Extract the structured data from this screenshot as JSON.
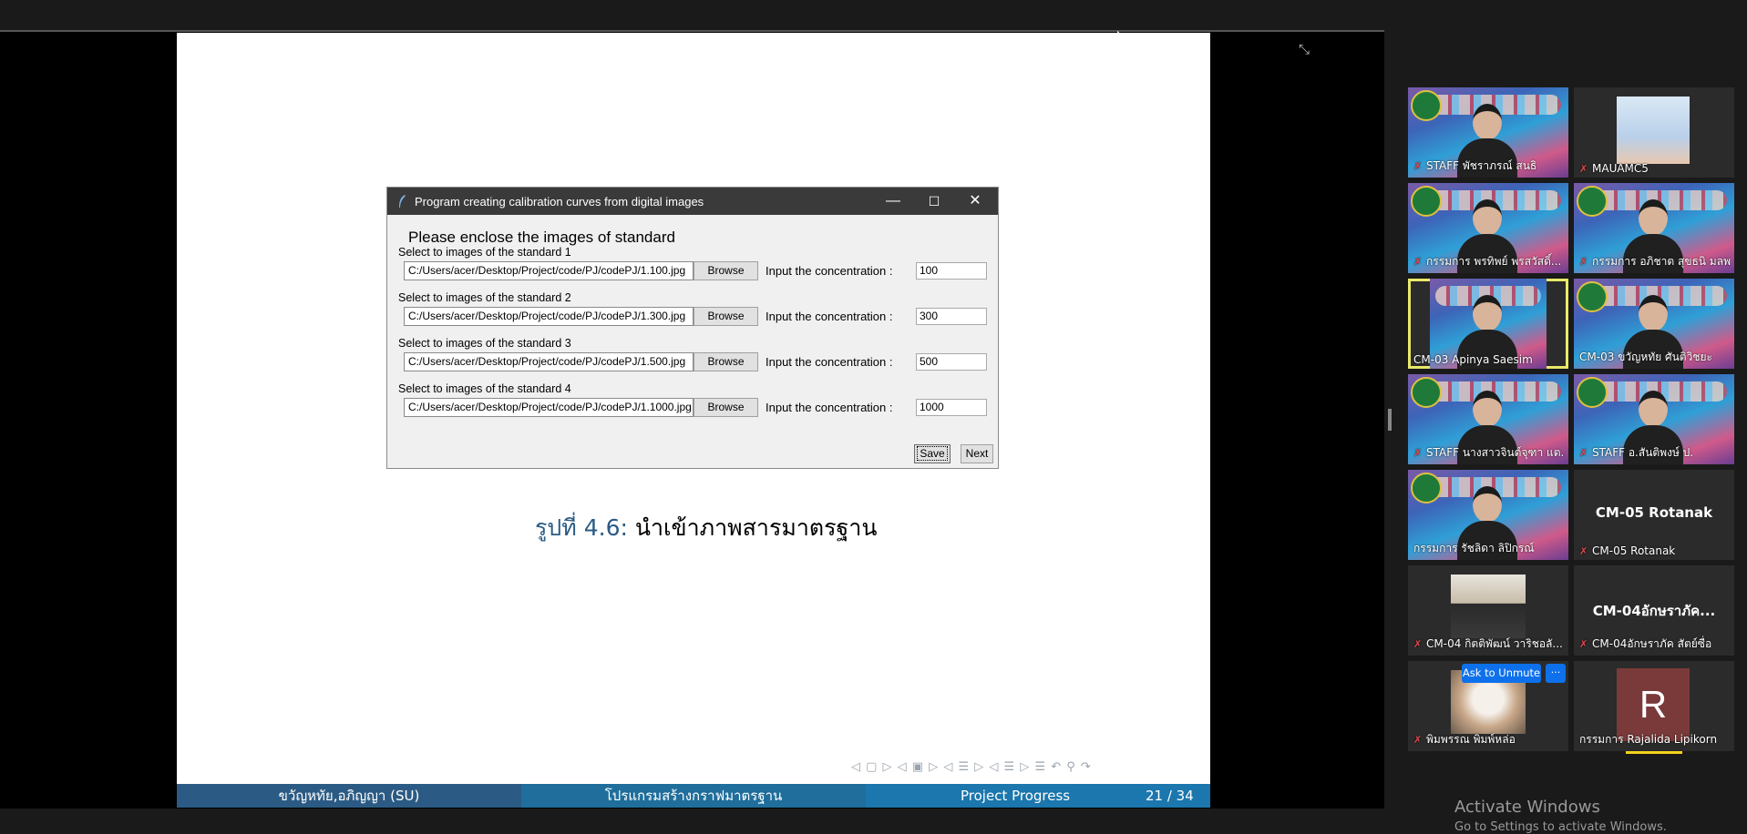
{
  "dialog": {
    "title": "Program creating calibration curves from digital images",
    "minimize_glyph": "—",
    "maximize_glyph": "☐",
    "close_glyph": "✕",
    "heading": "Please enclose the images of standard",
    "rows": [
      {
        "label": "Select to images of the standard 1",
        "path": "C:/Users/acer/Desktop/Project/code/PJ/codePJ/1.100.jpg",
        "browse": "Browse",
        "conc_label": "Input the concentration :",
        "conc": "100"
      },
      {
        "label": "Select to images of the standard 2",
        "path": "C:/Users/acer/Desktop/Project/code/PJ/codePJ/1.300.jpg",
        "browse": "Browse",
        "conc_label": "Input the concentration :",
        "conc": "300"
      },
      {
        "label": "Select to images of the standard 3",
        "path": "C:/Users/acer/Desktop/Project/code/PJ/codePJ/1.500.jpg",
        "browse": "Browse",
        "conc_label": "Input the concentration :",
        "conc": "500"
      },
      {
        "label": "Select to images of the standard 4",
        "path": "C:/Users/acer/Desktop/Project/code/PJ/codePJ/1.1000.jpg",
        "browse": "Browse",
        "conc_label": "Input the concentration :",
        "conc": "1000"
      }
    ],
    "save": "Save",
    "next": "Next"
  },
  "caption": {
    "number": "รูปที่ 4.6:",
    "text": " นำเข้าภาพสารมาตรฐาน"
  },
  "nav_symbols": "◁ ▢ ▷  ◁ ▣ ▷  ◁ ☰ ▷  ◁ ☰ ▷   ☰   ↶ ⚲ ↷",
  "footer": {
    "author": "ขวัญหทัย,อภิญญา (SU)",
    "title": "โปรแกรมสร้างกราฟมาตรฐาน",
    "section": "Project Progress",
    "page": "21 / 34"
  },
  "exit_fullscreen_icon": "⤡",
  "participants": [
    {
      "name": "STAFF พัชราภรณ์ สนธิ",
      "kind": "video",
      "muted": true
    },
    {
      "name": "MAUAMC5",
      "kind": "image",
      "muted": true
    },
    {
      "name": "กรรมการ พรทิพย์ พรสวัสดิ์...",
      "kind": "video",
      "muted": true
    },
    {
      "name": "กรรมการ อภิชาต สุขธนิ มลพ...",
      "kind": "video",
      "muted": true
    },
    {
      "name": "CM-03 Apinya Saesim",
      "kind": "video",
      "muted": false,
      "active": true
    },
    {
      "name": "CM-03 ขวัญหทัย ศันติวิชยะ",
      "kind": "video",
      "muted": false
    },
    {
      "name": "STAFF นางสาวจินต์จุฑา แต...",
      "kind": "video",
      "muted": true
    },
    {
      "name": "STAFF อ.สันติพงษ์  ป.",
      "kind": "video",
      "muted": true
    },
    {
      "name": "กรรมการ รัชลิดา ลิปิกรณ์",
      "kind": "video",
      "muted": false
    },
    {
      "name": "CM-05 Rotanak",
      "kind": "name",
      "center": "CM-05 Rotanak",
      "muted": true
    },
    {
      "name": "CM-04 กิตติพัฒน์ วาริชอลั...",
      "kind": "photo",
      "muted": true
    },
    {
      "name": "CM-04อักษราภัค สัตย์ซื่อ",
      "kind": "name",
      "center": "CM-04อักษราภัค...",
      "muted": true
    },
    {
      "name": "พิมพรรณ พิมพ์หล่อ",
      "kind": "photo",
      "muted": true
    },
    {
      "name": "กรรมการ Rajalida Lipikorn",
      "kind": "avatar",
      "initial": "R",
      "muted": false
    }
  ],
  "ask_unmute": "Ask to Unmute",
  "more": "···",
  "watermark": {
    "title": "Activate Windows",
    "subtitle": "Go to Settings to activate Windows."
  },
  "colors": {
    "footer_dark": "#2b5b84",
    "footer_mid": "#1f6e9c",
    "footer_light": "#1b77ad",
    "zoom_blue": "#0e71eb",
    "active_speaker": "#e8e86a",
    "muted_red": "#e5484d"
  }
}
